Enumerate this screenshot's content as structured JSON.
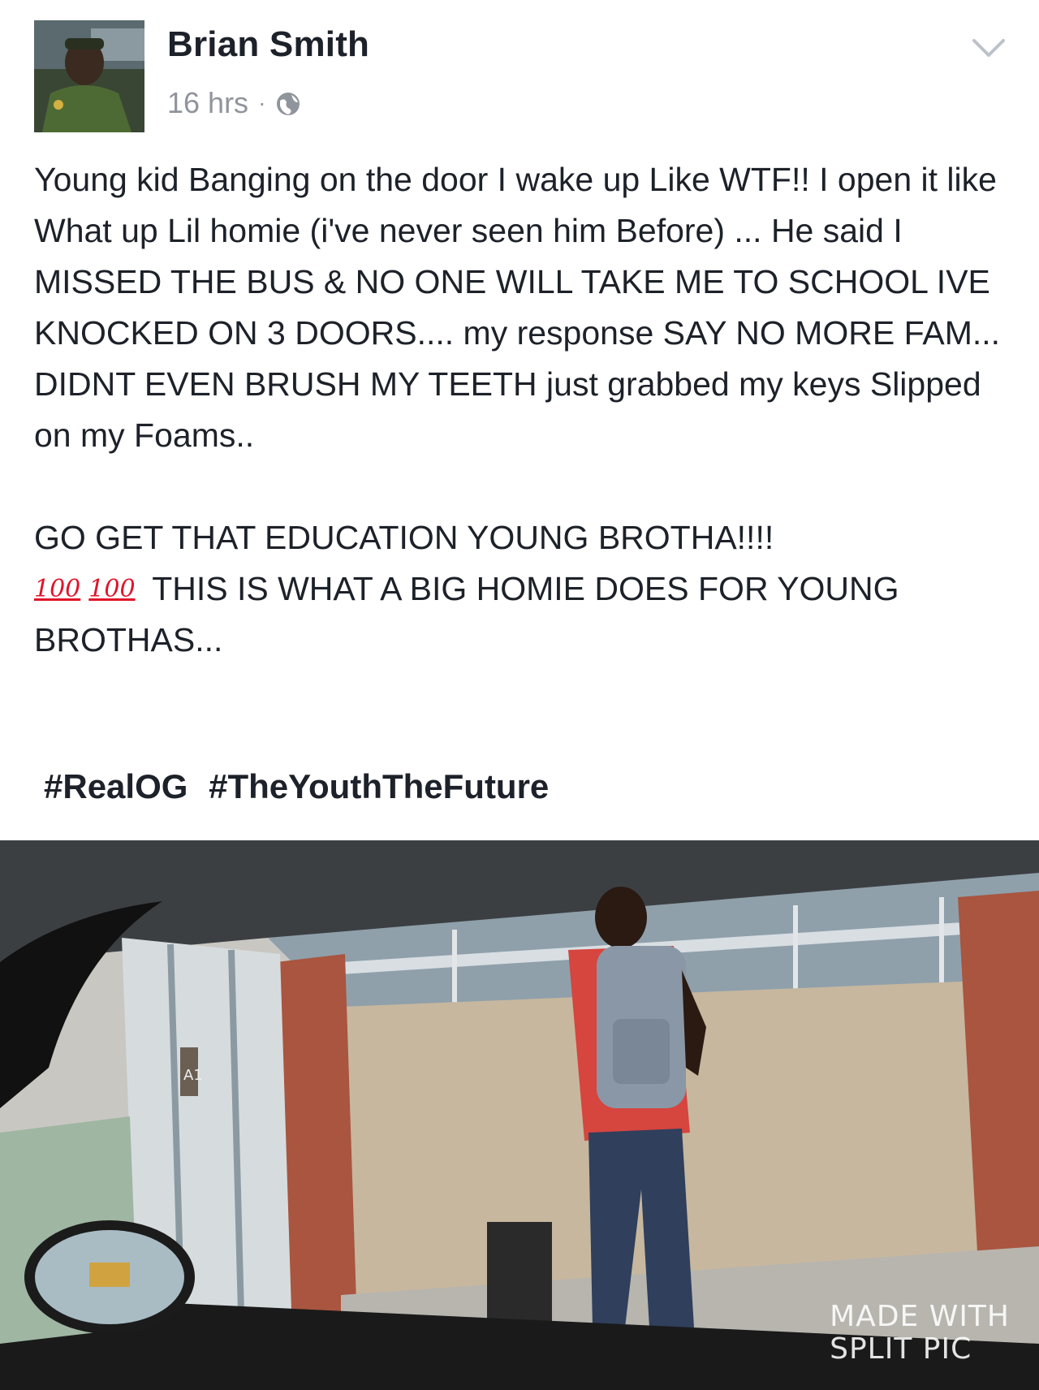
{
  "post": {
    "author": "Brian Smith",
    "time": "16 hrs",
    "separator": "·",
    "privacy_icon": "globe-icon",
    "menu_icon": "chevron-down-icon",
    "paragraphs": [
      "Young kid Banging on the door I wake up Like WTF!! I open it like What up Lil homie (i've never seen him Before) ... He said I MISSED THE BUS & NO ONE WILL TAKE ME TO SCHOOL IVE KNOCKED ON 3 DOORS.... my response SAY NO MORE FAM... DIDNT EVEN BRUSH MY TEETH just grabbed my keys Slipped on my Foams..",
      "GO GET THAT EDUCATION YOUNG BROTHA!!!!",
      "THIS IS WHAT A BIG HOMIE DOES FOR YOUNG BROTHAS..."
    ],
    "emoji": [
      "100",
      "100"
    ],
    "emoji_name": "hundred-points-icon",
    "hashtags": [
      "#RealOG",
      "#TheYouthTheFuture"
    ]
  },
  "photo": {
    "watermark_line1": "MADE WITH",
    "watermark_line2": "SPLIT PIC",
    "door_sign": "A1"
  },
  "colors": {
    "text": "#1d2129",
    "meta": "#90949c",
    "emoji_red": "#e0142a"
  }
}
